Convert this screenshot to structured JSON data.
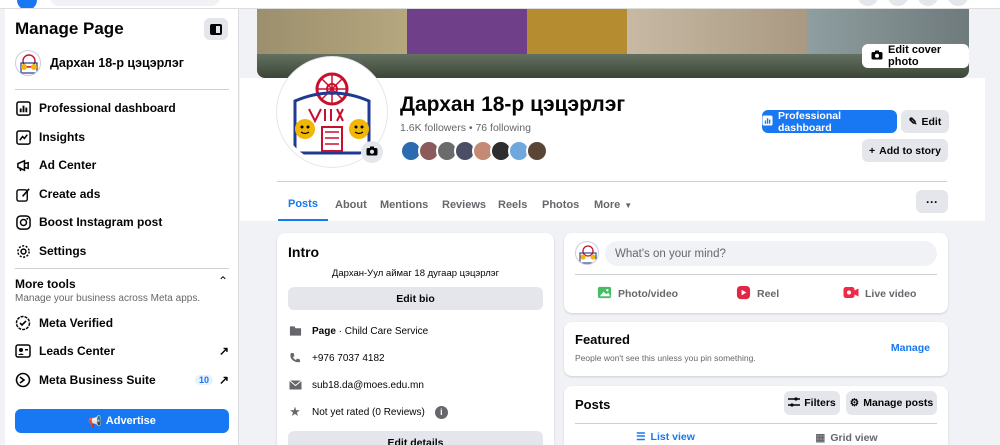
{
  "sidebar": {
    "title": "Manage Page",
    "page_name": "Дархан 18-р цэцэрлэг",
    "items": [
      {
        "label": "Professional dashboard",
        "icon": "dashboard-icon"
      },
      {
        "label": "Insights",
        "icon": "insights-icon"
      },
      {
        "label": "Ad Center",
        "icon": "megaphone-icon"
      },
      {
        "label": "Create ads",
        "icon": "pencil-icon"
      },
      {
        "label": "Boost Instagram post",
        "icon": "instagram-icon"
      },
      {
        "label": "Settings",
        "icon": "gear-icon"
      }
    ],
    "more_tools": {
      "title": "More tools",
      "subtitle": "Manage your business across Meta apps."
    },
    "tools": [
      {
        "label": "Meta Verified",
        "icon": "verified-icon"
      },
      {
        "label": "Leads Center",
        "icon": "leads-icon"
      },
      {
        "label": "Meta Business Suite",
        "icon": "business-suite-icon",
        "badge": "10"
      }
    ],
    "advertise_label": "Advertise"
  },
  "cover": {
    "edit_label": "Edit cover photo"
  },
  "profile": {
    "name": "Дархан 18-р цэцэрлэг",
    "followers_text": "1.6K followers • 76 following",
    "pro_dashboard_label": "Professional dashboard",
    "edit_label": "Edit",
    "add_story_label": "Add to story"
  },
  "tabs": [
    "Posts",
    "About",
    "Mentions",
    "Reviews",
    "Reels",
    "Photos",
    "More"
  ],
  "intro": {
    "title": "Intro",
    "bio": "Дархан-Уул аймаг 18 дугаар цэцэрлэг",
    "edit_bio_label": "Edit bio",
    "category_prefix": "Page",
    "category": " · Child Care Service",
    "phone": "+976 7037 4182",
    "email": "sub18.da@moes.edu.mn",
    "rating": "Not yet rated (0 Reviews)",
    "edit_details_label": "Edit details"
  },
  "composer": {
    "placeholder": "What's on your mind?",
    "photo_label": "Photo/video",
    "reel_label": "Reel",
    "live_label": "Live video"
  },
  "featured": {
    "title": "Featured",
    "subtitle": "People won't see this unless you pin something.",
    "manage_label": "Manage"
  },
  "posts": {
    "title": "Posts",
    "filters_label": "Filters",
    "manage_label": "Manage posts",
    "list_view_label": "List view",
    "grid_view_label": "Grid view"
  },
  "colors": {
    "accent": "#1877f2",
    "background": "#f0f2f5",
    "button_grey": "#e4e6eb"
  }
}
